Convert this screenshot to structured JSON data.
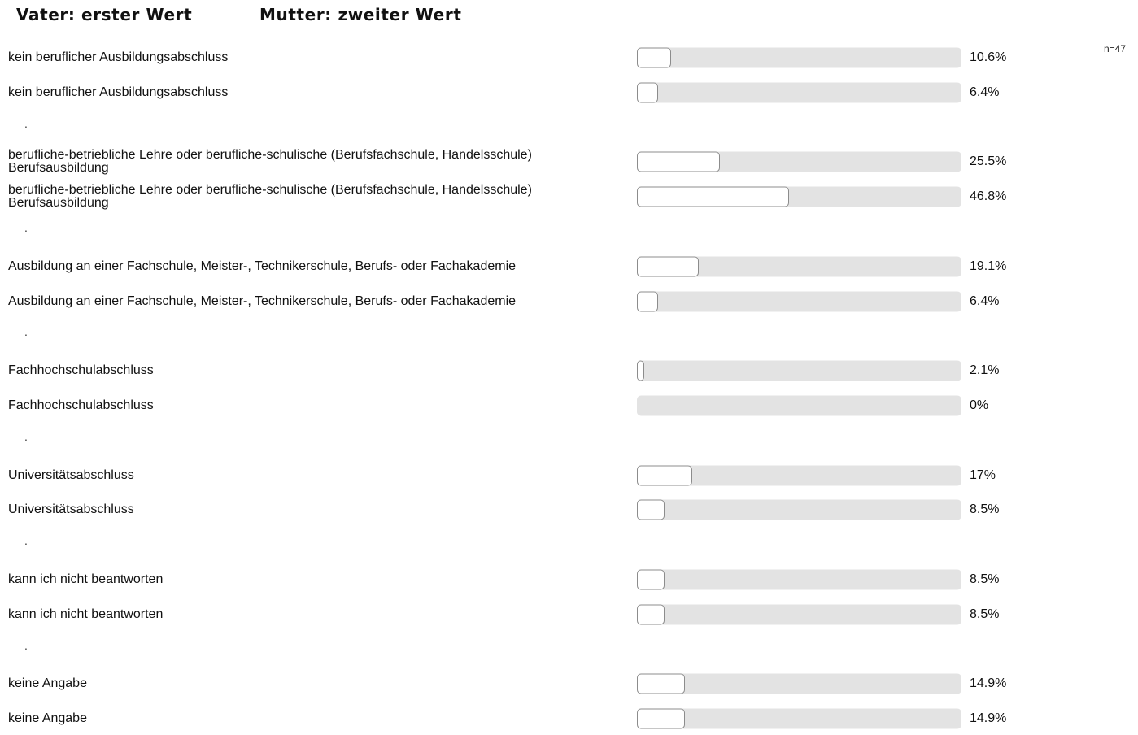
{
  "header": {
    "father_label": "Vater: erster Wert",
    "mother_label": "Mutter: zweiter Wert"
  },
  "n_label": "n=47",
  "separator": ".",
  "chart_data": {
    "type": "bar",
    "orientation": "horizontal",
    "categories": [
      "kein beruflicher Ausbildungsabschluss",
      "berufliche-betriebliche Lehre oder berufliche-schulische (Berufsfachschule, Handelsschule) Berufsausbildung",
      "Ausbildung an einer Fachschule, Meister-, Technikerschule, Berufs- oder Fachakademie",
      "Fachhochschulabschluss",
      "Universitätsabschluss",
      "kann ich nicht beantworten",
      "keine Angabe"
    ],
    "series": [
      {
        "name": "Vater: erster Wert",
        "values": [
          10.6,
          25.5,
          19.1,
          2.1,
          17,
          8.5,
          14.9
        ],
        "labels": [
          "10.6%",
          "25.5%",
          "19.1%",
          "2.1%",
          "17%",
          "8.5%",
          "14.9%"
        ]
      },
      {
        "name": "Mutter: zweiter Wert",
        "values": [
          6.4,
          46.8,
          6.4,
          0,
          8.5,
          8.5,
          14.9
        ],
        "labels": [
          "6.4%",
          "46.8%",
          "6.4%",
          "0%",
          "8.5%",
          "8.5%",
          "14.9%"
        ]
      }
    ],
    "xlim": [
      0,
      100
    ],
    "unit": "%"
  }
}
